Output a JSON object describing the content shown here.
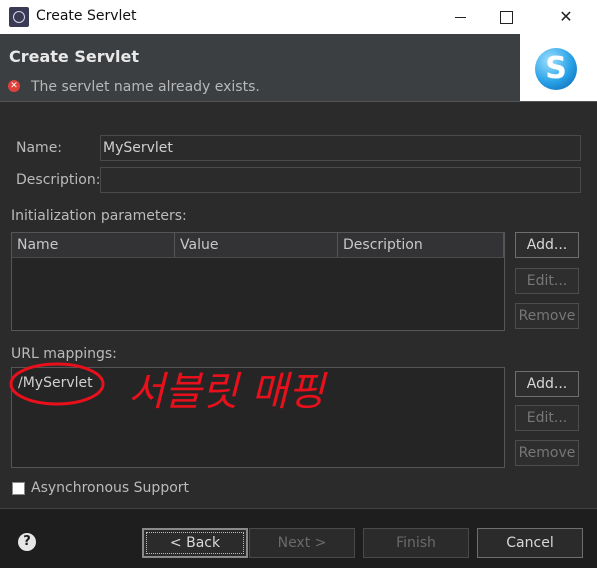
{
  "window": {
    "title": "Create Servlet"
  },
  "header": {
    "title": "Create Servlet",
    "error_message": "The servlet name already exists.",
    "logo_letter": "S"
  },
  "form": {
    "name_label": "Name:",
    "name_value": "MyServlet",
    "description_label": "Description:",
    "description_value": ""
  },
  "init_params": {
    "label": "Initialization parameters:",
    "columns": [
      "Name",
      "Value",
      "Description"
    ],
    "add": "Add...",
    "edit": "Edit...",
    "remove": "Remove"
  },
  "url_mappings": {
    "label": "URL mappings:",
    "items": [
      "/MyServlet"
    ],
    "add": "Add...",
    "edit": "Edit...",
    "remove": "Remove"
  },
  "async_support": {
    "label": "Asynchronous Support",
    "checked": false
  },
  "footer": {
    "back": "< Back",
    "next": "Next >",
    "finish": "Finish",
    "cancel": "Cancel"
  },
  "annotation": {
    "text": "서블릿 매핑",
    "color": "#e8101b"
  }
}
